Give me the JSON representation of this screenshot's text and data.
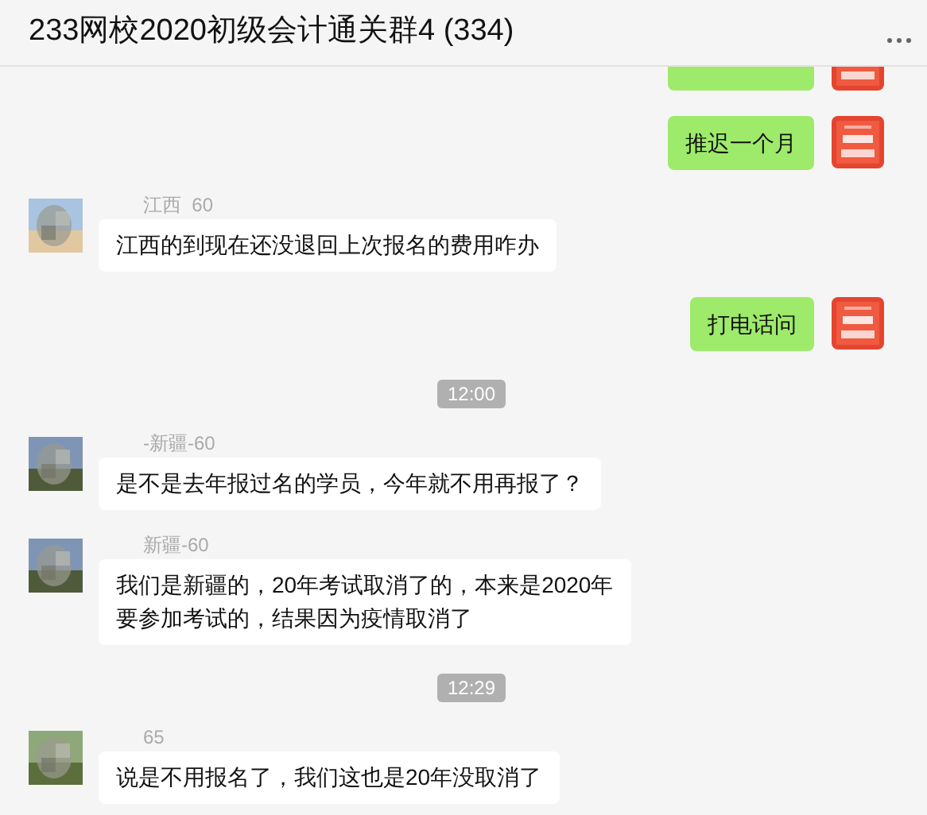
{
  "window": {
    "title": "233网校2020初级会计通关群4 (334)"
  },
  "messages": [
    {
      "kind": "clipped_outgoing"
    },
    {
      "kind": "outgoing",
      "text": "推迟一个月"
    },
    {
      "kind": "incoming",
      "sender": "江西  60",
      "text": "江西的到现在还没退回上次报名的费用咋办"
    },
    {
      "kind": "outgoing",
      "text": "打电话问"
    },
    {
      "kind": "time",
      "text": "12:00"
    },
    {
      "kind": "incoming",
      "sender": "-新疆-60",
      "text": "是不是去年报过名的学员，今年就不用再报了？"
    },
    {
      "kind": "incoming",
      "sender": "新疆-60",
      "text": "我们是新疆的，20年考试取消了的，本来是2020年要参加考试的，结果因为疫情取消了"
    },
    {
      "kind": "time",
      "text": "12:29"
    },
    {
      "kind": "incoming",
      "sender": "65",
      "text": "说是不用报名了，我们这也是20年没取消了"
    }
  ]
}
